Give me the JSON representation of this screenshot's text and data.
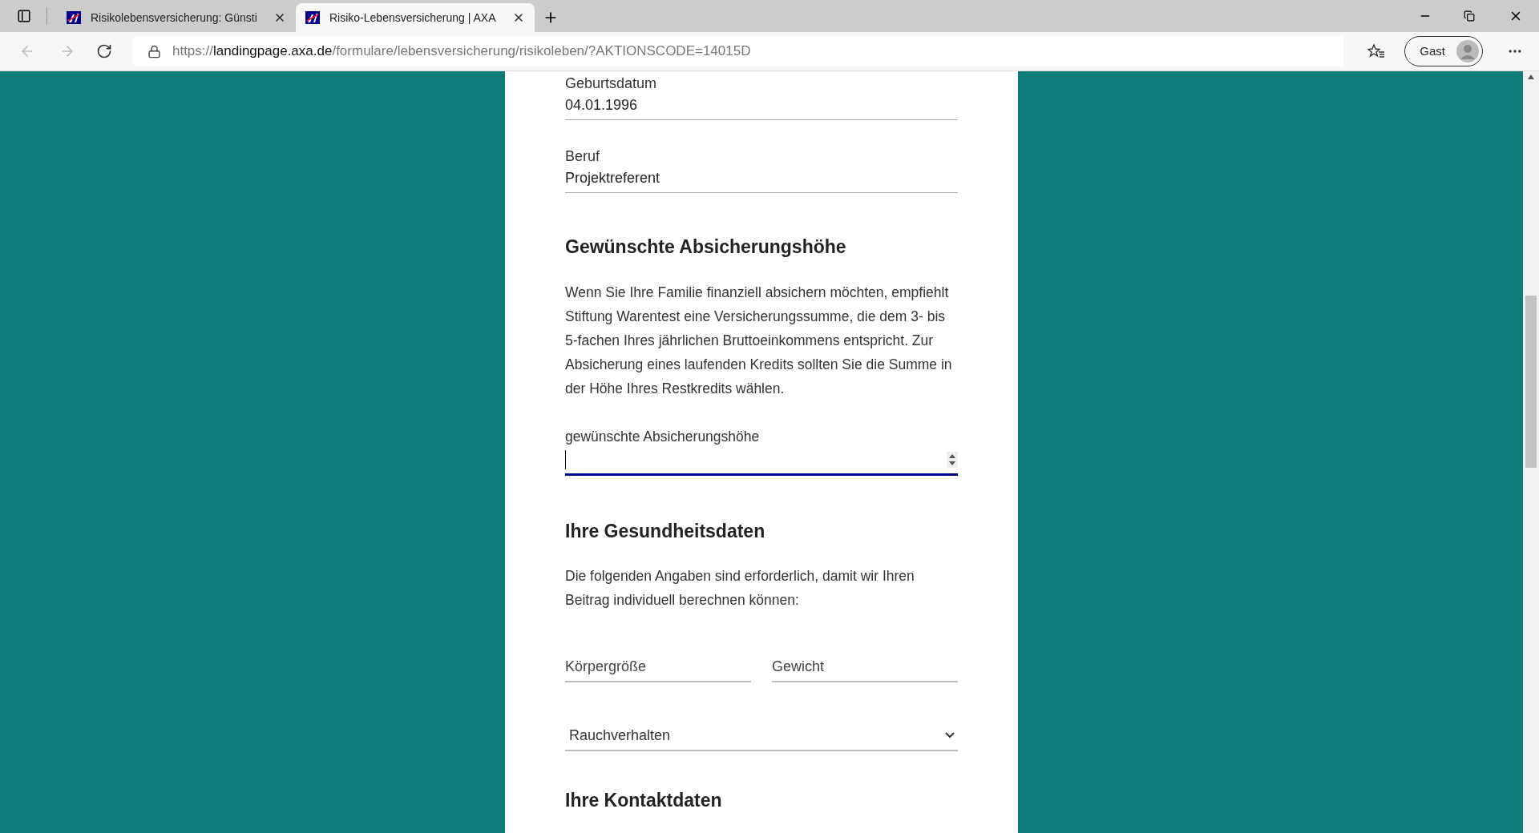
{
  "browser": {
    "tabs": [
      {
        "title": "Risikolebensversicherung: Günsti",
        "selected": false
      },
      {
        "title": "Risiko-Lebensversicherung | AXA",
        "selected": true
      }
    ],
    "address": {
      "host": "landingpage.axa.de",
      "path": "/formulare/lebensversicherung/risikoleben/?AKTIONSCODE=14015D",
      "prefix": "https://"
    },
    "profile": "Gast"
  },
  "form": {
    "fields": [
      {
        "label": "Geburtsdatum",
        "value": "04.01.1996"
      },
      {
        "label": "Beruf",
        "value": "Projektreferent"
      }
    ],
    "coverage": {
      "heading": "Gewünschte Absicherungshöhe",
      "text": "Wenn Sie Ihre Familie finanziell absichern möchten, empfiehlt Stiftung Warentest eine Versicherungssumme, die dem 3- bis 5-fachen Ihres jährlichen Bruttoeinkommens entspricht. Zur Absicherung eines laufenden Kredits sollten Sie die Summe in der Höhe Ihres Restkredits wählen.",
      "input_label": "gewünschte Absicherungshöhe",
      "focused": true
    },
    "health": {
      "heading": "Ihre Gesundheitsdaten",
      "text": "Die folgenden Angaben sind erforderlich, damit wir Ihren Beitrag individuell berechnen können:",
      "inputs": [
        {
          "placeholder": "Körpergröße"
        },
        {
          "placeholder": "Gewicht"
        }
      ],
      "select": "Rauchverhalten"
    },
    "contact": {
      "heading": "Ihre Kontaktdaten"
    }
  }
}
